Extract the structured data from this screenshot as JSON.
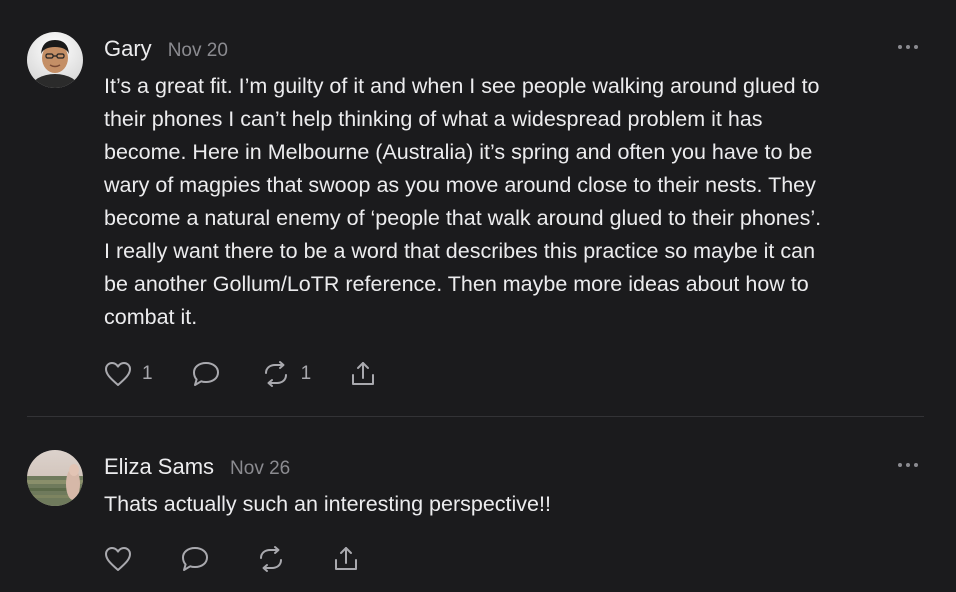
{
  "comments": [
    {
      "author": "Gary",
      "date": "Nov 20",
      "text": "It’s a great fit. I’m guilty of it and when I see people walking around glued to\ntheir phones I can’t help thinking of what a widespread problem it has\nbecome. Here in Melbourne (Australia) it’s spring and often you have to be\nwary of magpies that swoop as you move around close to their nests. They\nbecome a natural enemy of ‘people that walk around glued to their phones’.\nI really want there to be a word that describes this practice so maybe it can\nbe another Gollum/LoTR reference. Then maybe more ideas about how to\ncombat it.",
      "likes": "1",
      "restacks": "1"
    },
    {
      "author": "Eliza Sams",
      "date": "Nov 26",
      "text": "Thats actually such an interesting perspective!!"
    }
  ],
  "icons": {
    "like": "heart-icon",
    "reply": "speech-bubble-icon",
    "restack": "restack-icon",
    "share": "share-icon",
    "more": "more-dots-icon"
  },
  "colors": {
    "background": "#1b1b1d",
    "text": "#ececee",
    "muted": "#8b8b90",
    "icon": "#a9a9ae"
  }
}
